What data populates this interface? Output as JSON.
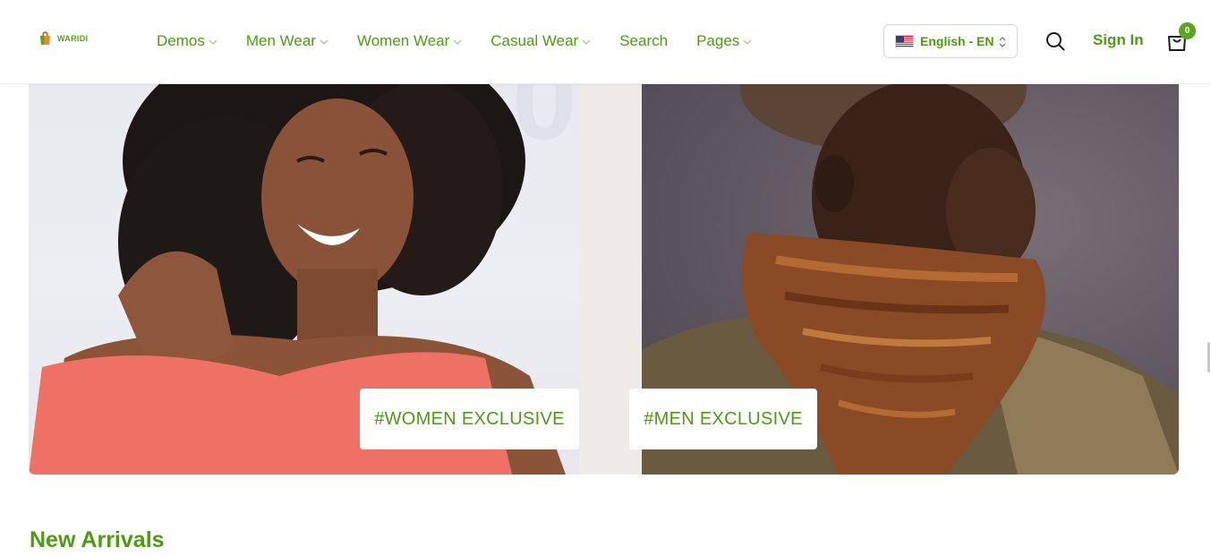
{
  "brand": {
    "name": "WARIDI",
    "accent": "#4e9a15",
    "badge_color": "#5aa61c"
  },
  "nav": {
    "items": [
      {
        "label": "Demos",
        "has_dropdown": true
      },
      {
        "label": "Men Wear",
        "has_dropdown": true
      },
      {
        "label": "Women Wear",
        "has_dropdown": true
      },
      {
        "label": "Casual Wear",
        "has_dropdown": true
      },
      {
        "label": "Search",
        "has_dropdown": false
      },
      {
        "label": "Pages",
        "has_dropdown": true
      }
    ]
  },
  "language": {
    "selected": "English - EN",
    "flag_icon": "us-flag-icon"
  },
  "header_actions": {
    "search_icon": "search-icon",
    "signin_label": "Sign In",
    "cart_icon": "cart-icon",
    "cart_count": "0"
  },
  "banner": {
    "women_tag": "#WOMEN EXCLUSIVE",
    "men_tag": "#MEN EXCLUSIVE"
  },
  "section": {
    "title": "New Arrivals"
  }
}
